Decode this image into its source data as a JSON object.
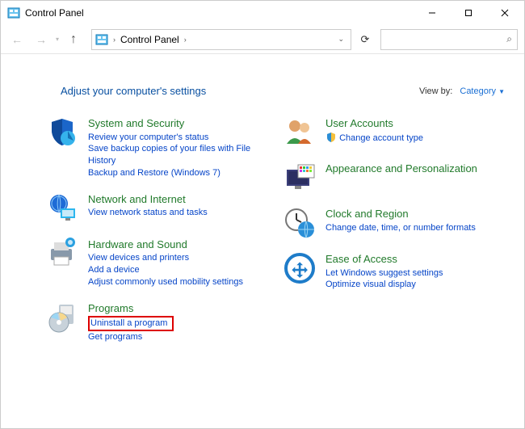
{
  "window": {
    "title": "Control Panel"
  },
  "breadcrumb": {
    "segments": [
      "Control Panel"
    ]
  },
  "heading": "Adjust your computer's settings",
  "viewby": {
    "label": "View by:",
    "value": "Category"
  },
  "categories_left": [
    {
      "name": "System and Security",
      "icon": "shield-pie-icon",
      "links": [
        "Review your computer's status",
        "Save backup copies of your files with File History",
        "Backup and Restore (Windows 7)"
      ]
    },
    {
      "name": "Network and Internet",
      "icon": "globe-monitor-icon",
      "links": [
        "View network status and tasks"
      ]
    },
    {
      "name": "Hardware and Sound",
      "icon": "printer-icon",
      "links": [
        "View devices and printers",
        "Add a device",
        "Adjust commonly used mobility settings"
      ]
    },
    {
      "name": "Programs",
      "icon": "disc-box-icon",
      "links": [
        "Uninstall a program",
        "Get programs"
      ],
      "highlight": 0
    }
  ],
  "categories_right": [
    {
      "name": "User Accounts",
      "icon": "people-icon",
      "links": [
        "Change account type"
      ],
      "link_icons": [
        "shield-small-icon"
      ]
    },
    {
      "name": "Appearance and Personalization",
      "icon": "monitor-grid-icon",
      "links": []
    },
    {
      "name": "Clock and Region",
      "icon": "clock-globe-icon",
      "links": [
        "Change date, time, or number formats"
      ]
    },
    {
      "name": "Ease of Access",
      "icon": "ease-of-access-icon",
      "links": [
        "Let Windows suggest settings",
        "Optimize visual display"
      ]
    }
  ]
}
